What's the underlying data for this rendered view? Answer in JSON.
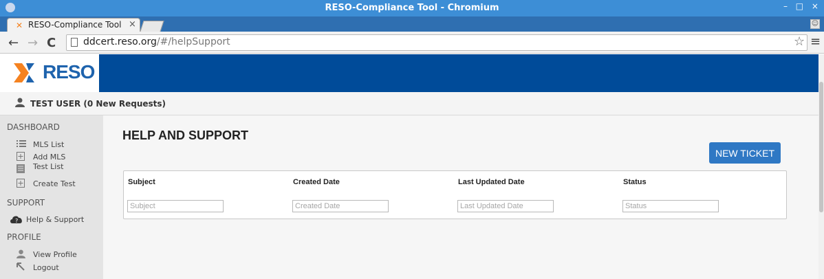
{
  "window": {
    "title": "RESO-Compliance Tool - Chromium",
    "controls": "– □ ×"
  },
  "browser": {
    "tab_label": "RESO-Compliance Tool",
    "tab_close": "×",
    "url_host": "ddcert.reso.org",
    "url_path": "/#/helpSupport",
    "back": "←",
    "forward": "→",
    "reload": "C",
    "star": "☆",
    "menu": "≡"
  },
  "header": {
    "logo_text": "RESO",
    "brand_blue": "#004b99",
    "logo_orange": "#f58220"
  },
  "userbar": {
    "label": "TEST USER (0 New Requests)"
  },
  "sidebar": {
    "dashboard_heading": "DASHBOARD",
    "mls_list": "MLS List",
    "add_mls": "Add MLS",
    "test_list": "Test List",
    "create_test": "Create Test",
    "support_heading": "SUPPORT",
    "help_support": "Help & Support",
    "profile_heading": "PROFILE",
    "view_profile": "View Profile",
    "logout": "Logout"
  },
  "main": {
    "title": "HELP AND SUPPORT",
    "new_ticket_label": "NEW TICKET",
    "button_color": "#2f78c4",
    "columns": [
      {
        "label": "Subject",
        "placeholder": "Subject"
      },
      {
        "label": "Created Date",
        "placeholder": "Created Date"
      },
      {
        "label": "Last Updated Date",
        "placeholder": "Last Updated Date"
      },
      {
        "label": "Status",
        "placeholder": "Status"
      }
    ]
  }
}
